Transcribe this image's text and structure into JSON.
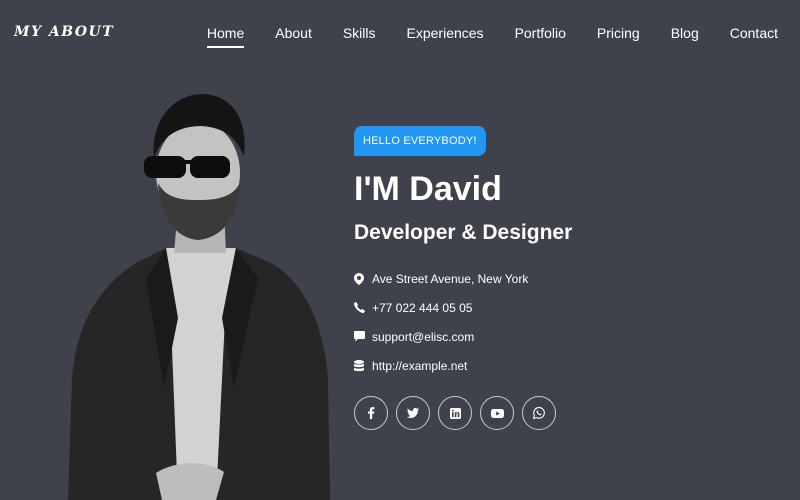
{
  "brand": {
    "logo": "MY ABOUT"
  },
  "nav": {
    "items": [
      {
        "label": "Home",
        "active": true
      },
      {
        "label": "About"
      },
      {
        "label": "Skills"
      },
      {
        "label": "Experiences"
      },
      {
        "label": "Portfolio"
      },
      {
        "label": "Pricing"
      },
      {
        "label": "Blog"
      },
      {
        "label": "Contact"
      }
    ]
  },
  "hero": {
    "badge": "HELLO EVERYBODY!",
    "name": "I'M David",
    "role": "Developer & Designer",
    "contact": {
      "address": "Ave Street Avenue, New York",
      "phone": "+77 022 444 05 05",
      "email": "support@elisc.com",
      "website": "http://example.net"
    },
    "socials": [
      "facebook-icon",
      "twitter-icon",
      "linkedin-icon",
      "youtube-icon",
      "whatsapp-icon"
    ]
  },
  "colors": {
    "background": "#3f424b",
    "accent": "#2196f3",
    "text": "#ffffff"
  }
}
